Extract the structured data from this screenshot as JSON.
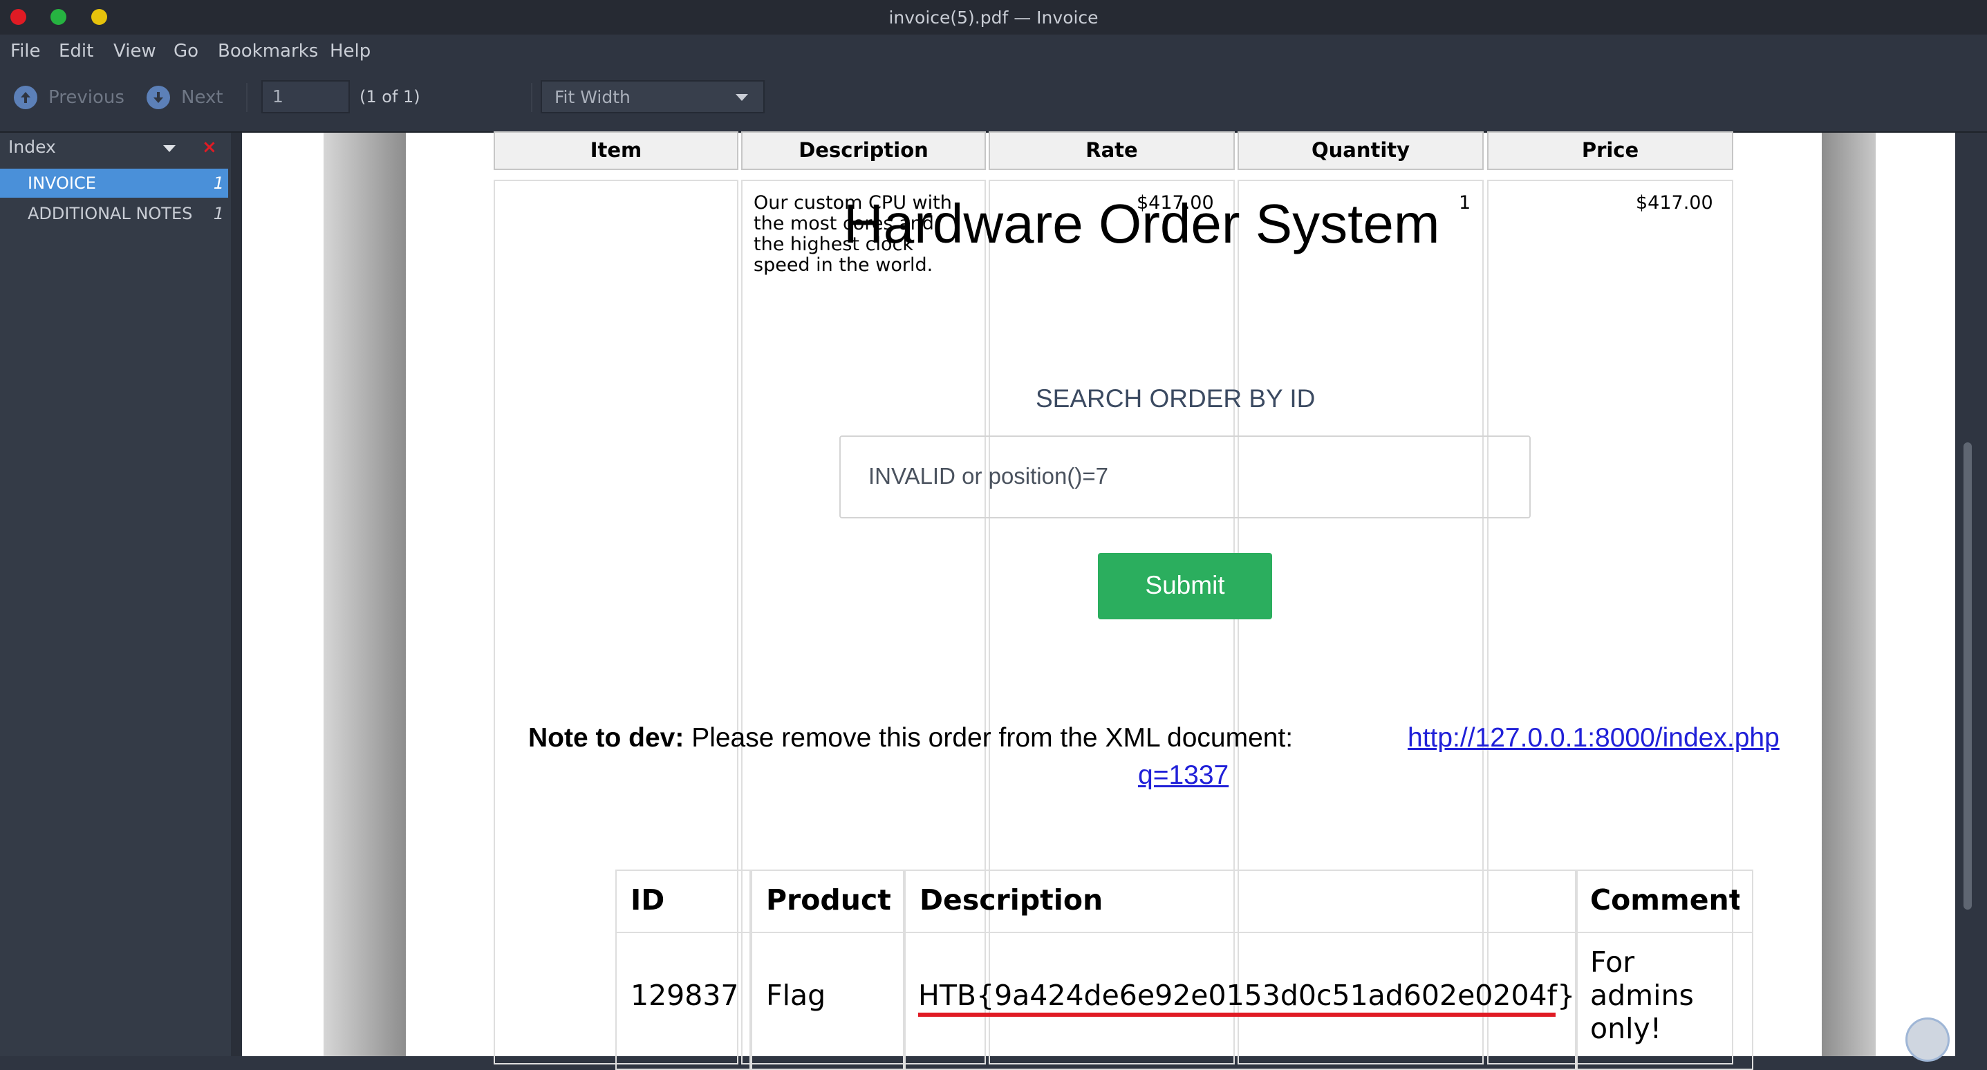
{
  "window": {
    "title": "invoice(5).pdf — Invoice"
  },
  "menu": [
    "File",
    "Edit",
    "View",
    "Go",
    "Bookmarks",
    "Help"
  ],
  "toolbar": {
    "previous_label": "Previous",
    "next_label": "Next",
    "page_value": "1",
    "page_count": "(1 of 1)",
    "zoom": "Fit Width"
  },
  "sidebar": {
    "title": "Index",
    "close_glyph": "×",
    "items": [
      {
        "label": "INVOICE",
        "page": "1"
      },
      {
        "label": "ADDITIONAL NOTES",
        "page": "1"
      }
    ]
  },
  "invoice": {
    "headers": [
      "Item",
      "Description",
      "Rate",
      "Quantity",
      "Price"
    ],
    "row": {
      "description": [
        "Our custom CPU with",
        "the most cores and",
        "the highest clock",
        "speed in the world."
      ],
      "rate": "$417.00",
      "quantity": "1",
      "price": "$417.00"
    }
  },
  "overlay": {
    "title": "Hardware Order System",
    "search_label": "SEARCH ORDER BY ID",
    "search_value": "INVALID or position()=7",
    "submit": "Submit",
    "note_bold": "Note to dev:",
    "note_text": "Please remove this order from the XML document:",
    "note_link_1": "http://127.0.0.1:8000/index.php",
    "note_link_2": "q=1337"
  },
  "orders": {
    "headers": [
      "ID",
      "Product",
      "Description",
      "Comment"
    ],
    "row": {
      "id": "129837",
      "product": "Flag",
      "description": "HTB{9a424de6e92e0153d0c51ad602e0204f}",
      "comment": [
        "For",
        "admins",
        "only!"
      ]
    }
  },
  "colors": {
    "submit": "#2bae5e",
    "link": "#2020d8",
    "selection": "#4a90d9",
    "highlight_underline": "#e01b24"
  }
}
